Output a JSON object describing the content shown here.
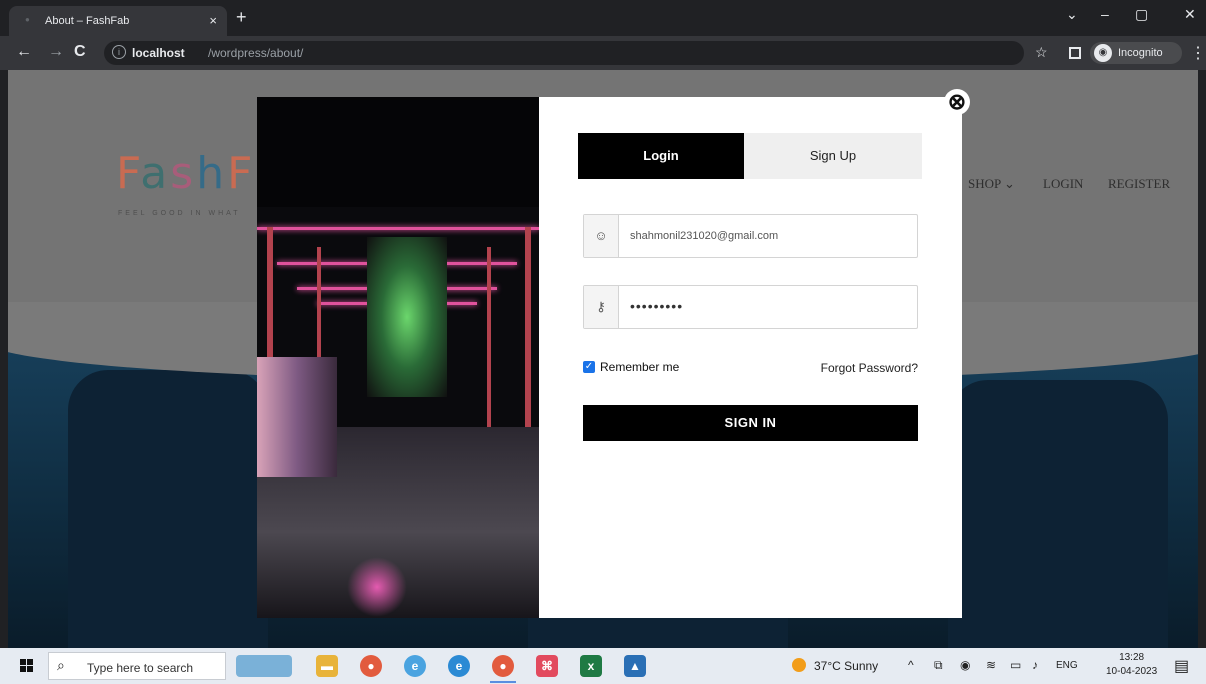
{
  "browser": {
    "tab_title": "About – FashFab",
    "tab_close": "×",
    "new_tab": "+",
    "url_host": "localhost",
    "url_path": "/wordpress/about/",
    "incognito_label": "Incognito",
    "window_minimize": "–",
    "window_restore": "▢",
    "window_close": "✕",
    "tab_search": "⌄"
  },
  "site": {
    "logo_parts": [
      "F",
      "a",
      "s",
      "h",
      "F"
    ],
    "tagline": "FEEL GOOD IN WHAT",
    "nav": [
      {
        "label": "SHOP ⌄"
      },
      {
        "label": "LOGIN"
      },
      {
        "label": "REGISTER"
      }
    ]
  },
  "modal": {
    "tabs": {
      "login": "Login",
      "signup": "Sign Up"
    },
    "email_value": "shahmonil231020@gmail.com",
    "password_mask": "•••••••••",
    "remember_label": "Remember me",
    "remember_checked": true,
    "forgot_label": "Forgot Password?",
    "submit_label": "SIGN IN",
    "close_icon": "⊗"
  },
  "taskbar": {
    "search_placeholder": "Type here to search",
    "weather": "37°C  Sunny",
    "lang": "ENG",
    "time": "13:28",
    "date": "10-04-2023"
  },
  "colors": {
    "modal_tab_active": "#000000",
    "modal_tab_inactive": "#efefef",
    "signin_button": "#000000",
    "checkbox": "#1a73e8"
  }
}
